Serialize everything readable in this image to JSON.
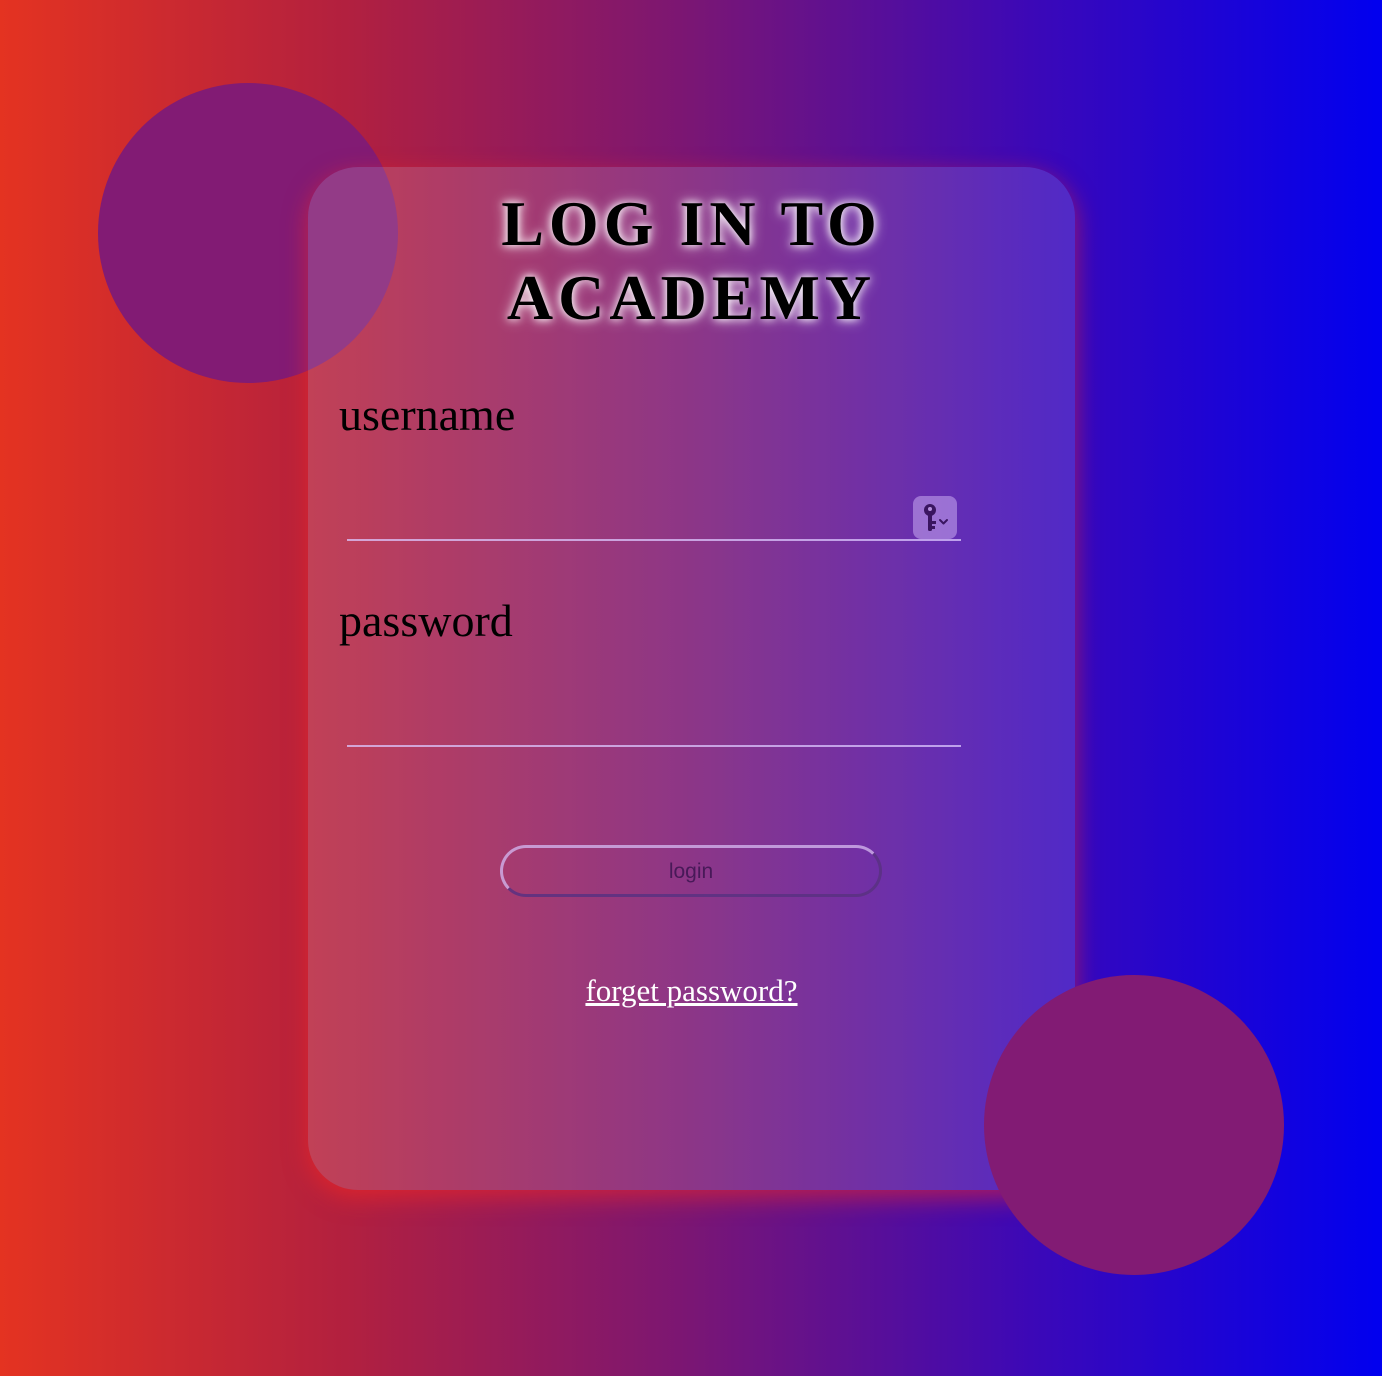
{
  "title": {
    "line1": "LOG IN TO",
    "line2": "ACADEMY"
  },
  "form": {
    "username_label": "username",
    "username_value": "",
    "password_label": "password",
    "password_value": "",
    "login_label": "login",
    "forgot_label": "forget password?"
  },
  "icons": {
    "autofill": "key-icon"
  },
  "colors": {
    "gradient_start": "#e43321",
    "gradient_end": "#0100ef",
    "circle": "#821b74",
    "link": "#ffffff"
  }
}
